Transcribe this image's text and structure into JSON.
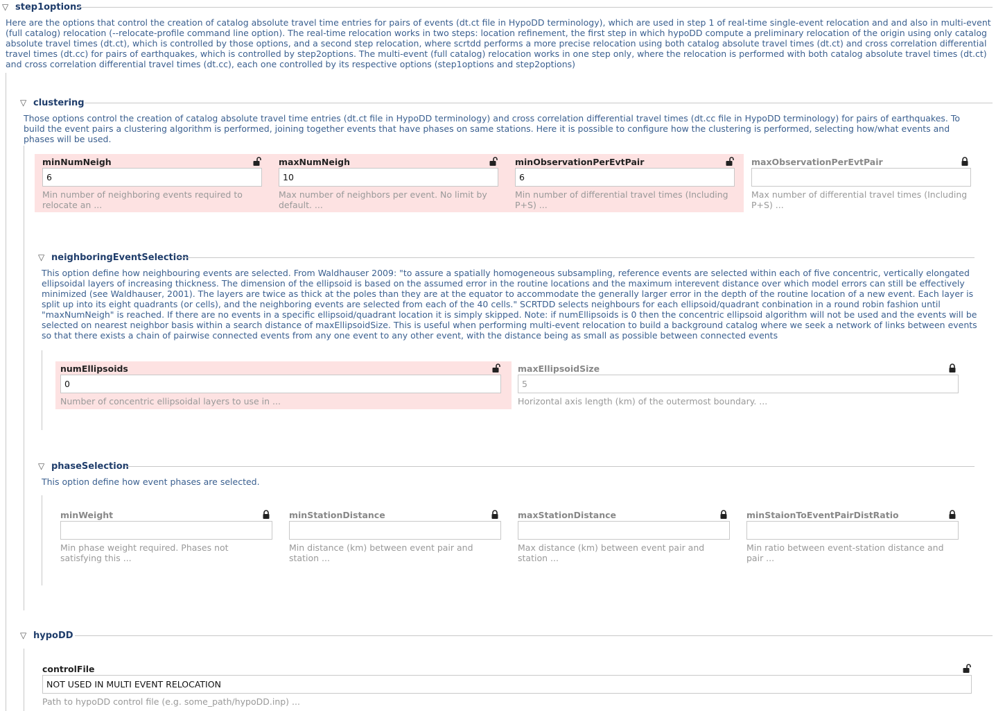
{
  "step1": {
    "title": "step1options",
    "description": "Here are the options that control the creation of catalog absolute travel time entries for pairs of events (dt.ct file in HypoDD terminology), which are used in step 1 of real-time single-event relocation and and also in multi-event (full catalog) relocation (--relocate-profile command line option). The real-time relocation works in two steps: location refinement, the first step in which hypoDD compute a preliminary relocation of the origin using only catalog absolute travel times (dt.ct), which is controlled by those options, and a second step relocation, where scrtdd performs a more precise relocation using both catalog absolute travel times (dt.ct) and cross correlation differential travel times (dt.cc) for pairs of earthquakes, which is controlled by step2options. The multi-event (full catalog) relocation works in one step only, where the relocation is performed with both catalog absolute travel times (dt.ct) and cross correlation differential travel times (dt.cc), each one controlled by its respective options (step1options and step2options)"
  },
  "clustering": {
    "title": "clustering",
    "description": "Those options control the creation of catalog absolute travel time entries (dt.ct file in HypoDD terminology) and cross correlation differential travel times (dt.cc file in HypoDD terminology) for pairs of earthquakes. To build the event pairs a clustering algorithm is performed, joining together events that have phases on same stations. Here it is possible to configure how the clustering is performed, selecting how/what events and phases will be used.",
    "params": [
      {
        "label": "minNumNeigh",
        "value": "6",
        "help": "Min number of neighboring events required to relocate an ...",
        "locked": false
      },
      {
        "label": "maxNumNeigh",
        "value": "10",
        "help": "Max number of neighbors per event. No limit by default. ...",
        "locked": false
      },
      {
        "label": "minObservationPerEvtPair",
        "value": "6",
        "help": "Min number of differential travel times (Including P+S) ...",
        "locked": false
      },
      {
        "label": "maxObservationPerEvtPair",
        "value": "",
        "help": "Max number of differential travel times (Including P+S) ...",
        "locked": true
      }
    ]
  },
  "neighboring": {
    "title": "neighboringEventSelection",
    "description": "This option define how neighbouring events are selected. From Waldhauser 2009: \"to assure a spatially homogeneous subsampling, reference events are selected within each of five concentric, vertically elongated ellipsoidal layers of increasing thickness. The dimension of the ellipsoid is based on the assumed error in the routine locations and the maximum interevent distance over which model errors can still be effectively minimized (see Waldhauser, 2001). The layers are twice as thick at the poles than they are at the equator to accommodate the generally larger error in the depth of the routine location of a new event. Each layer is split up into its eight quadrants (or cells), and the neighboring events are selected from each of the 40 cells.\" SCRTDD selects neighbours for each ellipsoid/quadrant conbination in a round robin fashion until \"maxNumNeigh\" is reached. If there are no events in a specific ellipsoid/quadrant location it is simply skipped. Note: if numEllipsoids is 0 then the concentric ellipsoid algorithm will not be used and the events will be selected on nearest neighbor basis within a search distance of maxEllipsoidSize. This is useful when performing multi-event relocation to build a background catalog where we seek a network of links between events so that there exists a chain of pairwise connected events from any one event to any other event, with the distance being as small as possible between connected events",
    "params": [
      {
        "label": "numEllipsoids",
        "value": "0",
        "help": "Number of concentric ellipsoidal layers to use in ...",
        "locked": false
      },
      {
        "label": "maxEllipsoidSize",
        "value": "5",
        "help": "Horizontal axis length (km) of the outermost boundary. ...",
        "locked": true
      }
    ]
  },
  "phase": {
    "title": "phaseSelection",
    "description": "This option define how event phases are selected.",
    "params": [
      {
        "label": "minWeight",
        "value": "",
        "help": "Min phase weight required. Phases not satisfying this ...",
        "locked": true
      },
      {
        "label": "minStationDistance",
        "value": "",
        "help": "Min distance (km) between event pair and station ...",
        "locked": true
      },
      {
        "label": "maxStationDistance",
        "value": "",
        "help": "Max distance (km) between event pair and station ...",
        "locked": true
      },
      {
        "label": "minStaionToEventPairDistRatio",
        "value": "",
        "help": "Min ratio between event-station distance and pair ...",
        "locked": true
      }
    ]
  },
  "hypodd": {
    "title": "hypoDD",
    "params": [
      {
        "label": "controlFile",
        "value": "NOT USED IN MULTI EVENT RELOCATION",
        "help": "Path to hypoDD control file (e.g. some_path/hypoDD.inp) ...",
        "locked": false
      }
    ]
  },
  "icons": {
    "expanded": "triangle-down",
    "locked": "closed-lock",
    "unlocked": "open-lock"
  }
}
